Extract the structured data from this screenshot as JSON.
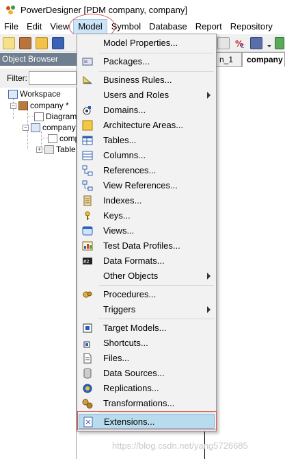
{
  "window": {
    "title": "PowerDesigner [PDM company, company]"
  },
  "menubar": {
    "items": [
      {
        "label": "File"
      },
      {
        "label": "Edit"
      },
      {
        "label": "View"
      },
      {
        "label": "Model"
      },
      {
        "label": "Symbol"
      },
      {
        "label": "Database"
      },
      {
        "label": "Report"
      },
      {
        "label": "Repository"
      }
    ]
  },
  "object_browser": {
    "header": "Object Browser",
    "filter_label": "Filter:",
    "filter_value": "",
    "tree": {
      "workspace": "Workspace",
      "company_model": "company *",
      "diagram": "Diagram_",
      "company_pkg": "company",
      "comp_item": "comp",
      "tables": "Table"
    }
  },
  "diagram_panel": {
    "tabs": [
      {
        "label": "n_1"
      },
      {
        "label": "company"
      }
    ]
  },
  "model_menu": {
    "items": [
      {
        "label": "Model Properties...",
        "icon": "none",
        "submenu": false
      },
      {
        "label": "Packages...",
        "icon": "packages-icon",
        "submenu": false
      },
      {
        "label": "Business Rules...",
        "icon": "business-rules-icon",
        "submenu": false
      },
      {
        "label": "Users and Roles",
        "icon": "none",
        "submenu": true
      },
      {
        "label": "Domains...",
        "icon": "domains-icon",
        "submenu": false
      },
      {
        "label": "Architecture Areas...",
        "icon": "architecture-areas-icon",
        "submenu": false
      },
      {
        "label": "Tables...",
        "icon": "tables-icon",
        "submenu": false
      },
      {
        "label": "Columns...",
        "icon": "columns-icon",
        "submenu": false
      },
      {
        "label": "References...",
        "icon": "references-icon",
        "submenu": false
      },
      {
        "label": "View References...",
        "icon": "view-references-icon",
        "submenu": false
      },
      {
        "label": "Indexes...",
        "icon": "indexes-icon",
        "submenu": false
      },
      {
        "label": "Keys...",
        "icon": "keys-icon",
        "submenu": false
      },
      {
        "label": "Views...",
        "icon": "views-icon",
        "submenu": false
      },
      {
        "label": "Test Data Profiles...",
        "icon": "test-data-profiles-icon",
        "submenu": false
      },
      {
        "label": "Data Formats...",
        "icon": "data-formats-icon",
        "submenu": false
      },
      {
        "label": "Other Objects",
        "icon": "none",
        "submenu": true
      },
      {
        "label": "Procedures...",
        "icon": "procedures-icon",
        "submenu": false
      },
      {
        "label": "Triggers",
        "icon": "none",
        "submenu": true
      },
      {
        "label": "Target Models...",
        "icon": "target-models-icon",
        "submenu": false
      },
      {
        "label": "Shortcuts...",
        "icon": "shortcuts-icon",
        "submenu": false
      },
      {
        "label": "Files...",
        "icon": "files-icon",
        "submenu": false
      },
      {
        "label": "Data Sources...",
        "icon": "data-sources-icon",
        "submenu": false
      },
      {
        "label": "Replications...",
        "icon": "replications-icon",
        "submenu": false
      },
      {
        "label": "Transformations...",
        "icon": "transformations-icon",
        "submenu": false
      },
      {
        "label": "Extensions...",
        "icon": "extensions-icon",
        "submenu": false
      }
    ]
  },
  "watermark": "https://blog.csdn.net/yang5726685",
  "colors": {
    "menu_active": "#cce4f7",
    "highlight": "#b8dcee",
    "annotation_red": "#e05050",
    "object_browser_header": "#6f7f8f"
  }
}
